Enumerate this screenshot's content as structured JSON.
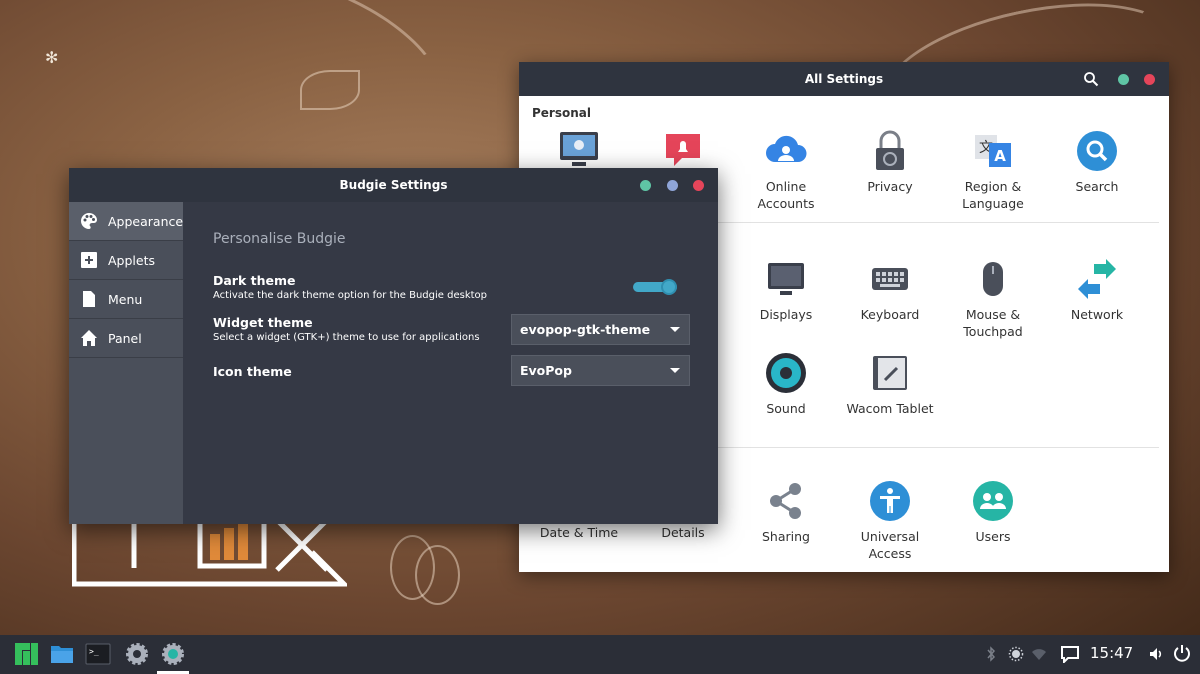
{
  "all_settings": {
    "title": "All Settings",
    "section_personal": "Personal",
    "personal_items": [
      {
        "icon": "desktop-background-icon",
        "label": ""
      },
      {
        "icon": "notifications-icon",
        "label": ""
      },
      {
        "icon": "online-accounts-icon",
        "label": "Online\nAccounts"
      },
      {
        "icon": "privacy-lock-icon",
        "label": "Privacy"
      },
      {
        "icon": "region-language-icon",
        "label": "Region &\nLanguage"
      },
      {
        "icon": "search-icon",
        "label": "Search"
      }
    ],
    "hardware_items": [
      {
        "icon": "displays-icon",
        "label": "Displays"
      },
      {
        "icon": "keyboard-icon",
        "label": "Keyboard"
      },
      {
        "icon": "mouse-icon",
        "label": "Mouse &\nTouchpad"
      },
      {
        "icon": "network-icon",
        "label": "Network"
      },
      {
        "icon": "sound-icon",
        "label": "Sound"
      },
      {
        "icon": "wacom-tablet-icon",
        "label": "Wacom Tablet"
      }
    ],
    "system_items": [
      {
        "icon": "date-time-icon",
        "label": "Date & Time"
      },
      {
        "icon": "details-icon",
        "label": "Details"
      },
      {
        "icon": "sharing-icon",
        "label": "Sharing"
      },
      {
        "icon": "universal-access-icon",
        "label": "Universal\nAccess"
      },
      {
        "icon": "users-icon",
        "label": "Users"
      }
    ]
  },
  "budgie": {
    "title": "Budgie Settings",
    "nav": [
      {
        "icon": "palette-icon",
        "label": "Appearance"
      },
      {
        "icon": "add-applet-icon",
        "label": "Applets"
      },
      {
        "icon": "document-icon",
        "label": "Menu"
      },
      {
        "icon": "home-icon",
        "label": "Panel"
      }
    ],
    "heading": "Personalise Budgie",
    "dark_theme": {
      "title": "Dark theme",
      "subtitle": "Activate the dark theme option for the Budgie desktop",
      "enabled": true
    },
    "widget_theme": {
      "title": "Widget theme",
      "subtitle": "Select a widget (GTK+) theme to use for applications",
      "value": "evopop-gtk-theme"
    },
    "icon_theme": {
      "title": "Icon theme",
      "value": "EvoPop"
    }
  },
  "taskbar": {
    "clock": "15:47",
    "apps": [
      "manjaro-menu-icon",
      "file-manager-icon",
      "terminal-icon",
      "settings-gear-icon",
      "budgie-settings-icon"
    ],
    "tray": [
      "bluetooth-icon",
      "brightness-icon",
      "wifi-icon",
      "notifications-chat-icon",
      "volume-icon",
      "power-icon"
    ]
  },
  "colors": {
    "header_dark": "#2f343f",
    "accent_blue": "#42a8c8",
    "dot_teal": "#5fc5a5",
    "dot_blue": "#8fa5d8",
    "dot_red": "#e5455a"
  }
}
